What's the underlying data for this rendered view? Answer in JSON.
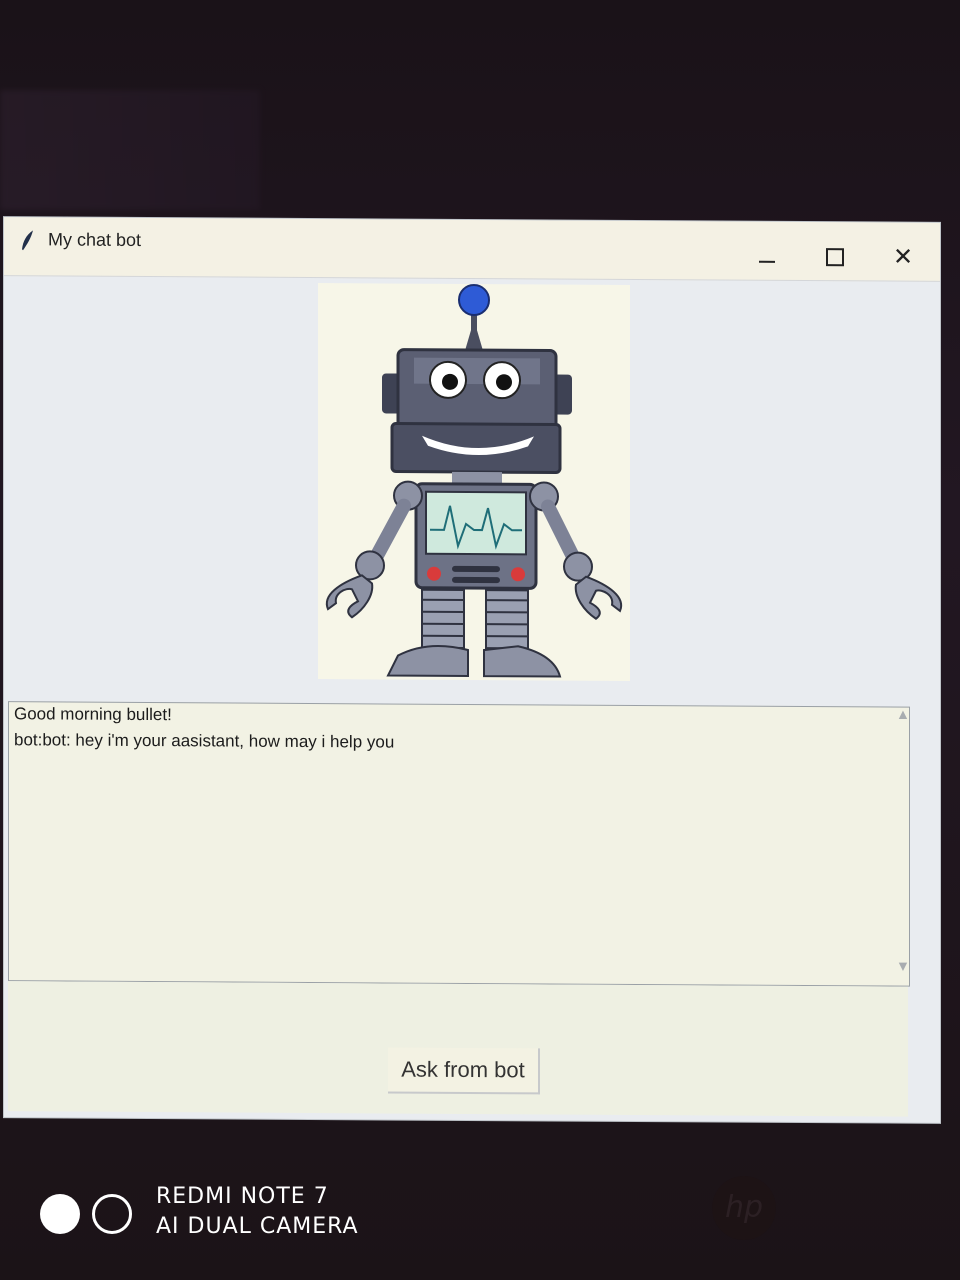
{
  "window": {
    "title": "My chat bot",
    "controls": {
      "minimize": "—",
      "maximize": "☐",
      "close": "✕"
    }
  },
  "chat": {
    "messages": [
      "Good morning bullet!",
      "bot:bot: hey i'm your aasistant, how may i help you"
    ]
  },
  "ask_button": {
    "label": "Ask from bot"
  },
  "camera_watermark": {
    "line1": "REDMI NOTE 7",
    "line2": "AI DUAL CAMERA"
  },
  "colors": {
    "robot_body": "#5b5f73",
    "robot_accent": "#2e5bd6",
    "screen": "#cfe9dd",
    "window_bg": "#e9ecf0"
  }
}
